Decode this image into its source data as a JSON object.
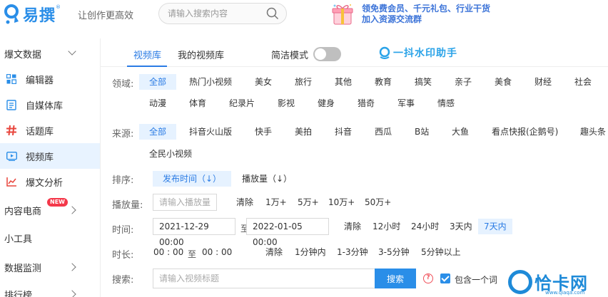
{
  "header": {
    "logo_text": "易撰",
    "logo_reg": "®",
    "slogan": "让创作更高效",
    "search_placeholder": "请输入搜索内容",
    "promo_line1": "领免费会员、千元礼包、行业干货",
    "promo_line2": "加入资源交流群"
  },
  "sidebar": {
    "items": [
      {
        "label": "爆文数据",
        "icon": "none",
        "type": "group",
        "chevron": "down"
      },
      {
        "label": "编辑器",
        "icon": "editor-grid-icon",
        "type": "item"
      },
      {
        "label": "自媒体库",
        "icon": "document-icon",
        "type": "item"
      },
      {
        "label": "话题库",
        "icon": "hashtag-icon",
        "type": "item"
      },
      {
        "label": "视频库",
        "icon": "video-icon",
        "type": "item",
        "active": true
      },
      {
        "label": "爆文分析",
        "icon": "line-chart-icon",
        "type": "item"
      },
      {
        "label": "内容电商",
        "icon": "none",
        "type": "group",
        "chevron": "right",
        "badge": "NEW"
      },
      {
        "label": "小工具",
        "icon": "none",
        "type": "group"
      },
      {
        "label": "数据监测",
        "icon": "none",
        "type": "group",
        "chevron": "right"
      },
      {
        "label": "排行榜",
        "icon": "none",
        "type": "group",
        "chevron": "right"
      }
    ]
  },
  "main": {
    "tabs": [
      {
        "label": "视频库",
        "active": true
      },
      {
        "label": "我的视频库",
        "active": false
      }
    ],
    "toggle_label": "简洁模式",
    "toggle_on": false,
    "watermark_helper": "一抖水印助手",
    "domain_label": "领域:",
    "domain_options_row1": [
      "全部",
      "热门小视频",
      "美女",
      "旅行",
      "其他",
      "教育",
      "搞笑",
      "亲子",
      "美食",
      "财经",
      "社会"
    ],
    "domain_options_row2": [
      "动漫",
      "体育",
      "纪录片",
      "影视",
      "健身",
      "猎奇",
      "军事",
      "情感"
    ],
    "source_label": "来源:",
    "source_options_row1": [
      "全部",
      "抖音火山版",
      "快手",
      "美拍",
      "抖音",
      "西瓜",
      "B站",
      "大鱼",
      "看点快报(企鹅号)",
      "趣头条"
    ],
    "source_options_row2": [
      "全民小视频"
    ],
    "sort_label": "排序:",
    "sort_options": [
      "发布时间（↓）",
      "播放量（↓）"
    ],
    "plays_label": "播放量:",
    "plays_placeholder": "请输入播放量",
    "plays_options": [
      "清除",
      "1万+",
      "5万+",
      "10万+",
      "50万+"
    ],
    "time_label": "时间:",
    "time_start": "2021-12-29 00:00",
    "time_sep": "至",
    "time_end": "2022-01-05 00:00",
    "time_options": [
      "清除",
      "12小时",
      "24小时",
      "3天内",
      "7天内"
    ],
    "duration_label": "时长:",
    "duration_start": "00 : 00",
    "duration_sep": "至",
    "duration_end": "00 : 00",
    "duration_options": [
      "清除",
      "1分钟内",
      "1-3分钟",
      "3-5分钟",
      "5分钟以上"
    ],
    "search_label": "搜索:",
    "search_placeholder": "请输入视频标题",
    "search_button": "搜索",
    "help_glyph": "?",
    "include_word_label": "包含一个词",
    "include_word_checked": true
  },
  "watermark": {
    "brand": "恰卡网",
    "url": "www.qiaqa.com"
  },
  "colors": {
    "accent": "#2a7be4",
    "selected_bg": "#e6f2ff",
    "brand_blue": "#2a8ee8",
    "new_badge": "#f4384a"
  }
}
